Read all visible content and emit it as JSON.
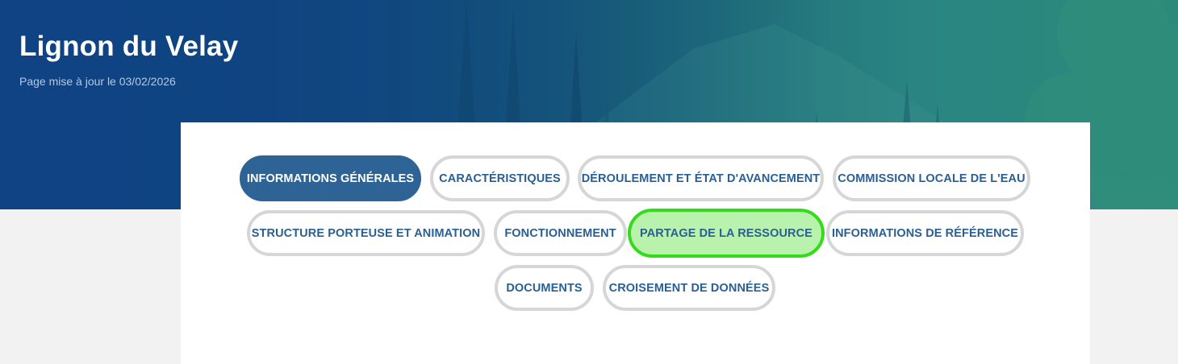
{
  "header": {
    "title": "Lignon du Velay",
    "updated": "Page mise à jour le 03/02/2026"
  },
  "colors": {
    "primary": "#2e6495",
    "tab_text": "#2a5f92",
    "tab_border": "#d6d6d6",
    "highlight_fill": "#b9f2ad",
    "highlight_border": "#33dc1a"
  },
  "tabs": [
    {
      "label": "INFORMATIONS GÉNÉRALES",
      "active": true
    },
    {
      "label": "CARACTÉRISTIQUES"
    },
    {
      "label": "DÉROULEMENT ET ÉTAT D'AVANCEMENT"
    },
    {
      "label": "COMMISSION LOCALE DE L'EAU"
    },
    {
      "label": "STRUCTURE PORTEUSE ET ANIMATION"
    },
    {
      "label": "FONCTIONNEMENT"
    },
    {
      "label": "PARTAGE DE LA RESSOURCE",
      "highlighted": true
    },
    {
      "label": "INFORMATIONS DE RÉFÉRENCE"
    },
    {
      "label": "DOCUMENTS"
    },
    {
      "label": "CROISEMENT DE DONNÉES"
    }
  ]
}
